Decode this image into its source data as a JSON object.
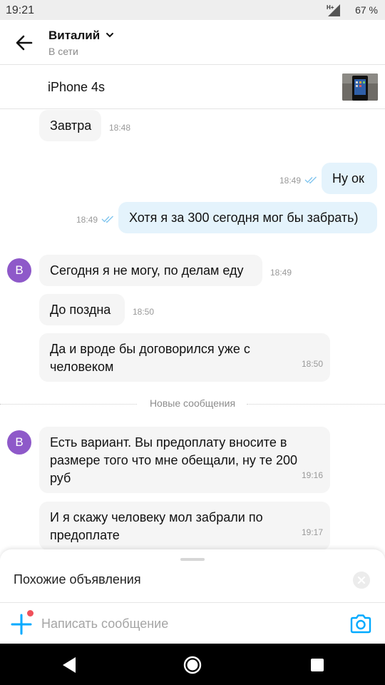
{
  "status_bar": {
    "time": "19:21",
    "network": "H+",
    "battery": "67 %"
  },
  "header": {
    "contact_name": "Виталий",
    "contact_status": "В сети",
    "back_icon": "arrow-left-icon",
    "chevron_icon": "chevron-down-icon"
  },
  "ad": {
    "title": "iPhone 4s",
    "thumbnail_icon": "phone-photo"
  },
  "messages": [
    {
      "dir": "in",
      "text": "Завтра",
      "time": "18:48"
    },
    {
      "dir": "out",
      "text": "Ну ок",
      "time": "18:49",
      "read": true
    },
    {
      "dir": "out",
      "text": "Хотя я за 300 сегодня мог бы забрать)",
      "time": "18:49",
      "read": true
    },
    {
      "dir": "in",
      "avatar": "В",
      "text": "Сегодня я не могу, по делам еду",
      "time": "18:49"
    },
    {
      "dir": "in",
      "text": "До поздна",
      "time": "18:50"
    },
    {
      "dir": "in",
      "text": "Да и вроде бы договорился уже с человеком",
      "time": "18:50"
    },
    {
      "dir": "in",
      "avatar": "В",
      "text": "Есть вариант. Вы предоплату вносите в размере того что мне обещали, ну те 200 руб",
      "time": "19:16"
    },
    {
      "dir": "in",
      "text": "И я скажу человеку мол забрали по предоплате",
      "time": "19:17"
    }
  ],
  "divider_label": "Новые сообщения",
  "similar_sheet": {
    "title": "Похожие объявления"
  },
  "composer": {
    "placeholder": "Написать сообщение",
    "value": ""
  },
  "colors": {
    "accent": "#00aaff",
    "incoming_bubble": "#f5f5f5",
    "outgoing_bubble": "#e4f3fc",
    "avatar": "#8e59c9",
    "notification_dot": "#f0505a"
  }
}
